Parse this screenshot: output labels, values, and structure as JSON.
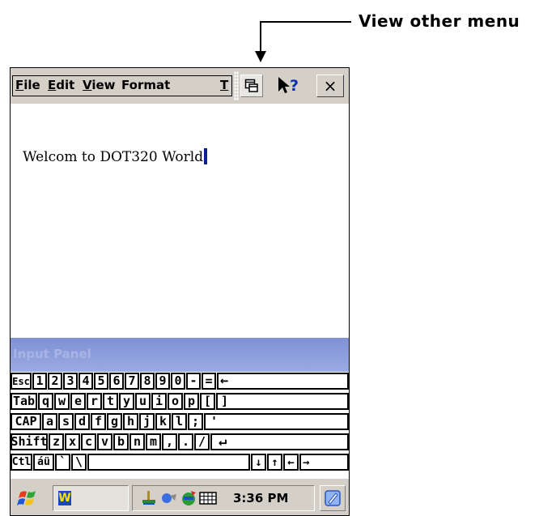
{
  "callout": {
    "label": "View other menu"
  },
  "menubar": {
    "menus": [
      {
        "accel": "F",
        "rest": "ile"
      },
      {
        "accel": "E",
        "rest": "dit"
      },
      {
        "accel": "V",
        "rest": "iew"
      },
      {
        "accel": "",
        "rest": "Format"
      },
      {
        "accel": "",
        "rest": "T"
      }
    ],
    "view_other_icon": "menu-window-icon",
    "help_label": "?",
    "close_label": "×"
  },
  "document": {
    "text": "Welcom to DOT320 World"
  },
  "input_panel": {
    "title": "Input Panel",
    "rows": [
      [
        "Esc",
        "1",
        "2",
        "3",
        "4",
        "5",
        "6",
        "7",
        "8",
        "9",
        "0",
        "-",
        "=",
        "←"
      ],
      [
        "Tab",
        "q",
        "w",
        "e",
        "r",
        "t",
        "y",
        "u",
        "i",
        "o",
        "p",
        "[",
        "]"
      ],
      [
        "CAP",
        "a",
        "s",
        "d",
        "f",
        "g",
        "h",
        "j",
        "k",
        "l",
        ";",
        "'"
      ],
      [
        "Shift",
        "z",
        "x",
        "c",
        "v",
        "b",
        "n",
        "m",
        ",",
        ".",
        "/",
        "↵"
      ],
      [
        "Ctl",
        "áü",
        "`",
        "\\",
        "",
        "↓",
        "↑",
        "←",
        "→"
      ]
    ]
  },
  "taskbar": {
    "start_icon": "windows-flag-icon",
    "active_app_icon": "wordpad-icon",
    "tray_icons": [
      "network-icon",
      "sync-icon",
      "connectivity-icon",
      "keyboard-icon"
    ],
    "time": "3:36 PM",
    "sip_icon": "input-panel-icon"
  }
}
